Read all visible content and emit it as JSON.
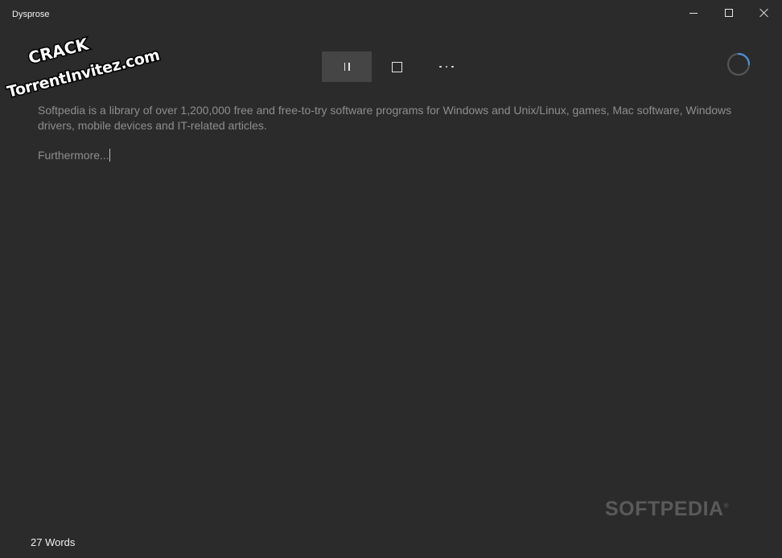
{
  "window": {
    "title": "Dysprose",
    "minimize_icon": "minimize-icon",
    "maximize_icon": "maximize-icon",
    "close_icon": "close-icon"
  },
  "watermark": {
    "line1": "CRACK",
    "line2": "TorrentInvitez.com"
  },
  "toolbar": {
    "pause_icon": "pause-icon",
    "stop_icon": "stop-icon",
    "more_icon": "more-options-icon"
  },
  "status": {
    "spinner_icon": "progress-ring-icon"
  },
  "document": {
    "paragraph1": "Softpedia is a library of over 1,200,000 free and free-to-try software programs for Windows and Unix/Linux, games, Mac software, Windows drivers, mobile devices and IT-related articles.",
    "paragraph2": "Furthermore..."
  },
  "footer": {
    "word_count": "27 Words",
    "brand": "SOFTPEDIA",
    "brand_mark": "®"
  },
  "colors": {
    "background": "#2b2b2b",
    "text_dim": "#8e8e8e",
    "accent": "#4a90d9"
  }
}
